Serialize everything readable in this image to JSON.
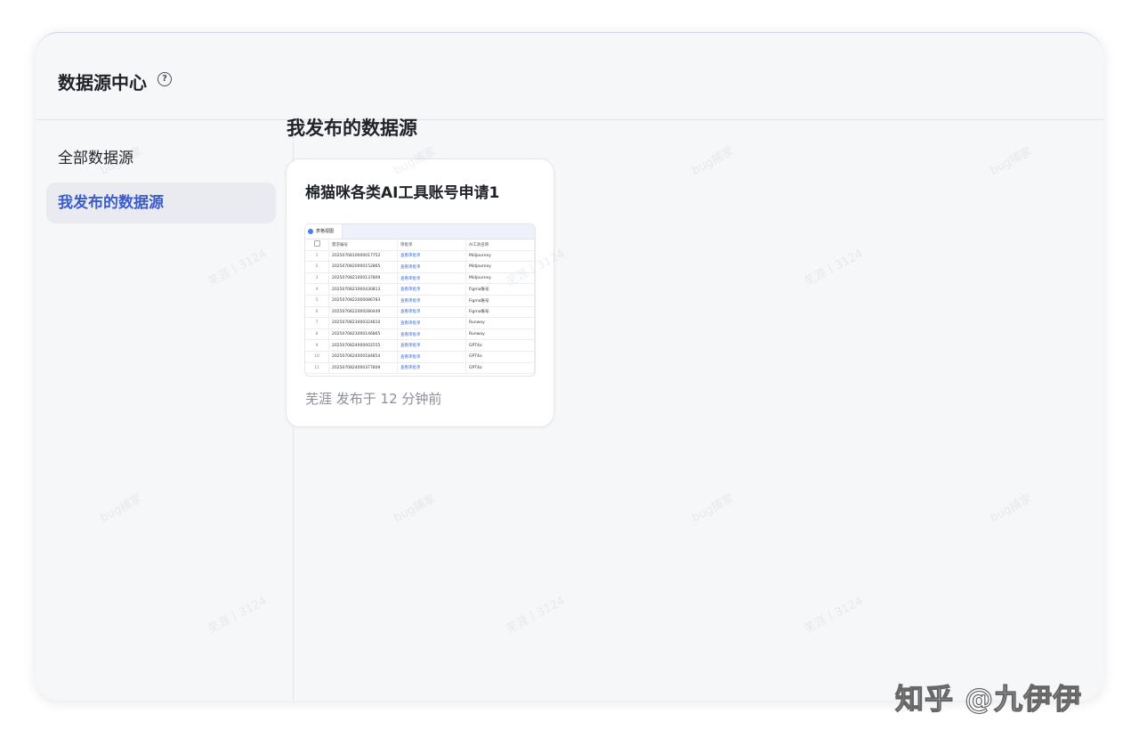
{
  "header": {
    "title": "数据源中心",
    "help_icon": "?"
  },
  "sidebar": {
    "items": [
      {
        "label": "全部数据源",
        "active": false
      },
      {
        "label": "我发布的数据源",
        "active": true
      }
    ]
  },
  "main": {
    "title": "我发布的数据源",
    "card": {
      "title": "棉猫咪各类AI工具账号申请1",
      "meta": "芜涯 发布于 12 分钟前",
      "preview": {
        "tab_label": "表格视图",
        "columns": [
          "需求编号",
          "审批单",
          "AI工具名称"
        ],
        "rows": [
          [
            "1",
            "2025070810000017752",
            "查看审批单",
            "Midjourney"
          ],
          [
            "2",
            "2025070820000152865",
            "查看审批单",
            "Midjourney"
          ],
          [
            "3",
            "2025070821000137809",
            "查看审批单",
            "Midjourney"
          ],
          [
            "4",
            "2025070821000430813",
            "查看审批单",
            "Figma账号"
          ],
          [
            "5",
            "2025070822000086783",
            "查看审批单",
            "Figma账号"
          ],
          [
            "6",
            "2025070822000280449",
            "查看审批单",
            "Figma账号"
          ],
          [
            "7",
            "2025070823000324810",
            "查看审批单",
            "Runway"
          ],
          [
            "8",
            "2025070823000146865",
            "查看审批单",
            "Runway"
          ],
          [
            "9",
            "2025070824000002555",
            "查看审批单",
            "GPT4o"
          ],
          [
            "10",
            "2025070824000184854",
            "查看审批单",
            "GPT4o"
          ],
          [
            "11",
            "2025070824000377809",
            "查看审批单",
            "GPT4o"
          ]
        ]
      }
    }
  },
  "watermark": {
    "text_a": "bug捕家",
    "text_b": "芜涯丨3124"
  },
  "brand": {
    "text": "知乎 @九伊伊"
  }
}
